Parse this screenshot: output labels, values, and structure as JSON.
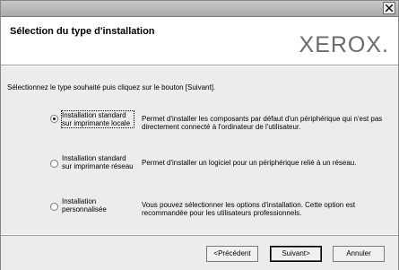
{
  "header": {
    "title": "Sélection du type d'installation",
    "logo_text": "XEROX."
  },
  "content": {
    "instruction": "Sélectionnez le type souhaité puis cliquez sur le bouton [Suivant].",
    "options": [
      {
        "label_line1": "Installation standard",
        "label_line2": "sur imprimante locale",
        "description": "Permet d'installer les composants par défaut d'un périphérique qui n'est pas directement connecté à l'ordinateur de l'utilisateur.",
        "selected": true
      },
      {
        "label_line1": "Installation standard",
        "label_line2": "sur imprimante réseau",
        "description": "Permet d'installer un logiciel pour un périphérique relié à un réseau.",
        "selected": false
      },
      {
        "label_line1": "Installation",
        "label_line2": "personnalisée",
        "description": "Vous pouvez sélectionner les options d'installation. Cette option est recommandée pour les utilisateurs professionnels.",
        "selected": false
      }
    ]
  },
  "footer": {
    "back_label": "<Précédent",
    "next_label": "Suivant>",
    "cancel_label": "Annuler"
  },
  "icons": {
    "close": "close-icon"
  }
}
